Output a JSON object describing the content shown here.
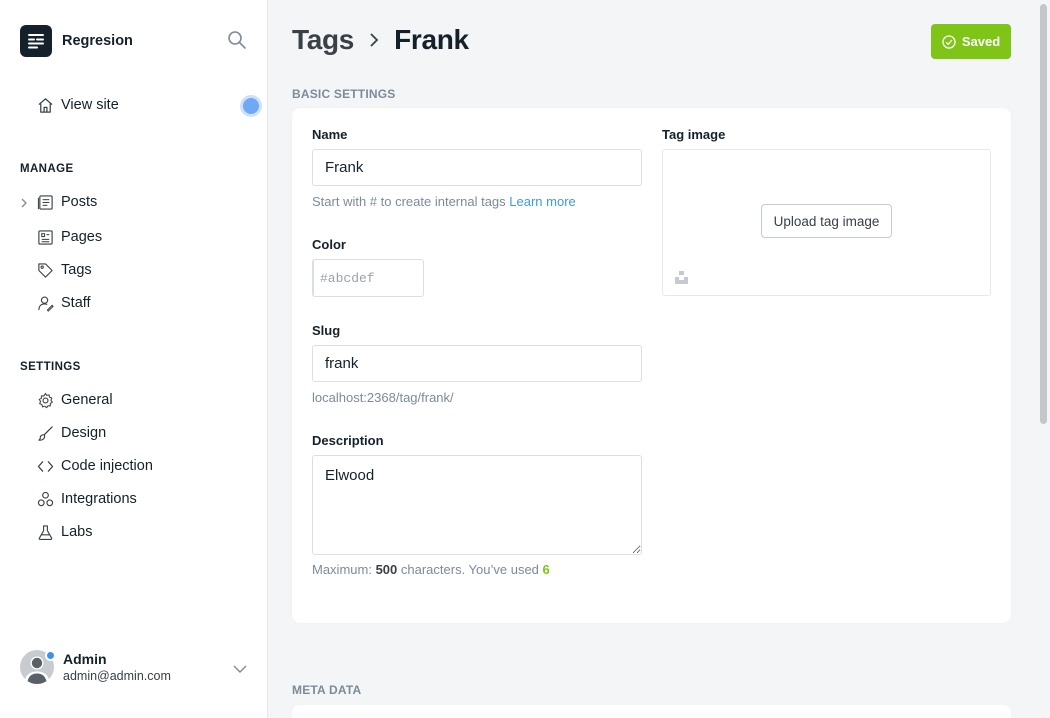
{
  "brand": {
    "name": "Regresion",
    "logo_icon": "ghost-menu-icon"
  },
  "sidebar": {
    "view_site": "View site",
    "manage_title": "MANAGE",
    "manage_items": [
      {
        "label": "Posts",
        "icon": "posts-icon"
      },
      {
        "label": "Pages",
        "icon": "pages-icon"
      },
      {
        "label": "Tags",
        "icon": "tag-icon"
      },
      {
        "label": "Staff",
        "icon": "staff-icon"
      }
    ],
    "settings_title": "SETTINGS",
    "settings_items": [
      {
        "label": "General",
        "icon": "gear-icon"
      },
      {
        "label": "Design",
        "icon": "brush-icon"
      },
      {
        "label": "Code injection",
        "icon": "code-icon"
      },
      {
        "label": "Integrations",
        "icon": "integrations-icon"
      },
      {
        "label": "Labs",
        "icon": "flask-icon"
      }
    ],
    "user": {
      "name": "Admin",
      "email": "admin@admin.com"
    }
  },
  "header": {
    "crumb_parent": "Tags",
    "crumb_current": "Frank",
    "saved_label": "Saved"
  },
  "basic": {
    "section_title": "BASIC SETTINGS",
    "name_label": "Name",
    "name_value": "Frank",
    "name_hint": "Start with # to create internal tags",
    "learn_more": "Learn more",
    "color_label": "Color",
    "color_placeholder": "#abcdef",
    "slug_label": "Slug",
    "slug_value": "frank",
    "slug_url": "localhost:2368/tag/frank/",
    "description_label": "Description",
    "description_value": "Elwood",
    "desc_hint_prefix": "Maximum: ",
    "desc_max": "500",
    "desc_hint_mid": " characters. You’ve used ",
    "desc_used": "6",
    "tag_image_label": "Tag image",
    "upload_label": "Upload tag image"
  },
  "meta": {
    "section_title": "META DATA"
  },
  "colors": {
    "accent_green": "#7ec518",
    "link_blue": "#3d9be0"
  }
}
